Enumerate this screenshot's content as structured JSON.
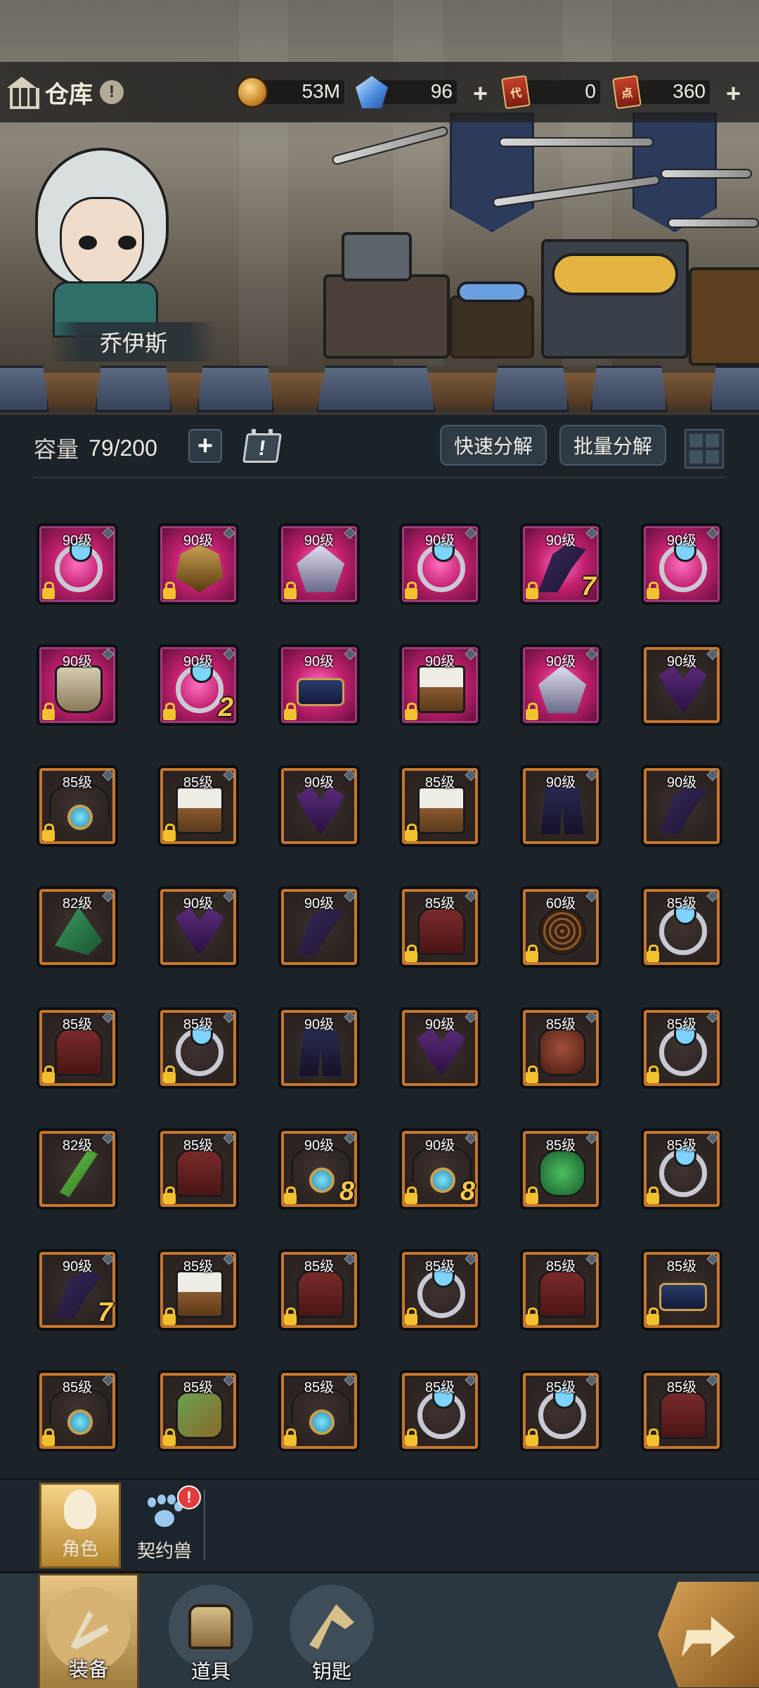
{
  "header": {
    "title": "仓库",
    "info_icon": "!",
    "resources": [
      {
        "icon": "coin-icon",
        "value": "53M",
        "has_plus": false
      },
      {
        "icon": "crystal-icon",
        "value": "96",
        "has_plus": true
      },
      {
        "icon": "ticket-icon",
        "ticket_mark": "代",
        "value": "0",
        "has_plus": false
      },
      {
        "icon": "ticket-icon",
        "ticket_mark": "点",
        "value": "360",
        "has_plus": true
      }
    ],
    "plus_symbol": "+"
  },
  "character": {
    "name": "乔伊斯"
  },
  "capacity": {
    "label": "容量",
    "value": "79/200",
    "plus_symbol": "+"
  },
  "actions": {
    "quick_decompose": "快速分解",
    "batch_decompose": "批量分解"
  },
  "items": [
    [
      {
        "lvl": "90级",
        "q": "purple",
        "art": "ring"
      },
      {
        "lvl": "90级",
        "q": "purple",
        "art": "gold"
      },
      {
        "lvl": "90级",
        "q": "purple",
        "art": "spike"
      },
      {
        "lvl": "90级",
        "q": "purple",
        "art": "ring"
      },
      {
        "lvl": "90级",
        "q": "purple",
        "art": "claw",
        "count": "7"
      },
      {
        "lvl": "90级",
        "q": "purple",
        "art": "ring"
      }
    ],
    [
      {
        "lvl": "90级",
        "q": "purple",
        "art": "armor"
      },
      {
        "lvl": "90级",
        "q": "purple",
        "art": "ring",
        "count": "2"
      },
      {
        "lvl": "90级",
        "q": "purple",
        "art": "belt"
      },
      {
        "lvl": "90级",
        "q": "purple",
        "art": "boots"
      },
      {
        "lvl": "90级",
        "q": "purple",
        "art": "spike"
      },
      {
        "lvl": "90级",
        "q": "orange",
        "art": "mask",
        "lock": false
      }
    ],
    [
      {
        "lvl": "85级",
        "q": "orange",
        "art": "amulet"
      },
      {
        "lvl": "85级",
        "q": "orange",
        "art": "boots"
      },
      {
        "lvl": "90级",
        "q": "orange",
        "art": "mask",
        "lock": false
      },
      {
        "lvl": "85级",
        "q": "orange",
        "art": "boots"
      },
      {
        "lvl": "90级",
        "q": "orange",
        "art": "pants",
        "lock": false
      },
      {
        "lvl": "90级",
        "q": "orange",
        "art": "claw",
        "lock": false
      }
    ],
    [
      {
        "lvl": "82级",
        "q": "orange",
        "art": "hat",
        "lock": false
      },
      {
        "lvl": "90级",
        "q": "orange",
        "art": "mask",
        "lock": false
      },
      {
        "lvl": "90级",
        "q": "orange",
        "art": "claw",
        "lock": false
      },
      {
        "lvl": "85级",
        "q": "orange",
        "art": "fur"
      },
      {
        "lvl": "60级",
        "q": "orange",
        "art": "net"
      },
      {
        "lvl": "85级",
        "q": "orange",
        "art": "ring"
      }
    ],
    [
      {
        "lvl": "85级",
        "q": "orange",
        "art": "fur"
      },
      {
        "lvl": "85级",
        "q": "orange",
        "art": "ring"
      },
      {
        "lvl": "90级",
        "q": "orange",
        "art": "pants",
        "lock": false
      },
      {
        "lvl": "90级",
        "q": "orange",
        "art": "mask",
        "lock": false
      },
      {
        "lvl": "85级",
        "q": "orange",
        "art": "wolf"
      },
      {
        "lvl": "85级",
        "q": "orange",
        "art": "ring"
      }
    ],
    [
      {
        "lvl": "82级",
        "q": "orange",
        "art": "blade",
        "lock": false
      },
      {
        "lvl": "85级",
        "q": "orange",
        "art": "fur"
      },
      {
        "lvl": "90级",
        "q": "orange",
        "art": "amulet",
        "count": "8"
      },
      {
        "lvl": "90级",
        "q": "orange",
        "art": "amulet",
        "count": "8"
      },
      {
        "lvl": "85级",
        "q": "orange",
        "art": "leaf"
      },
      {
        "lvl": "85级",
        "q": "orange",
        "art": "ring"
      }
    ],
    [
      {
        "lvl": "90级",
        "q": "orange",
        "art": "claw",
        "count": "7",
        "lock": false
      },
      {
        "lvl": "85级",
        "q": "orange",
        "art": "boots"
      },
      {
        "lvl": "85级",
        "q": "orange",
        "art": "fur"
      },
      {
        "lvl": "85级",
        "q": "orange",
        "art": "ring"
      },
      {
        "lvl": "85级",
        "q": "orange",
        "art": "fur"
      },
      {
        "lvl": "85级",
        "q": "orange",
        "art": "belt"
      }
    ],
    [
      {
        "lvl": "85级",
        "q": "orange",
        "art": "amulet"
      },
      {
        "lvl": "85级",
        "q": "orange",
        "art": "bracer"
      },
      {
        "lvl": "85级",
        "q": "orange",
        "art": "amulet"
      },
      {
        "lvl": "85级",
        "q": "orange",
        "art": "ring"
      },
      {
        "lvl": "85级",
        "q": "orange",
        "art": "ring"
      },
      {
        "lvl": "85级",
        "q": "orange",
        "art": "fur"
      }
    ]
  ],
  "subtabs": [
    {
      "label": "角色",
      "active": true,
      "icon": "character-icon"
    },
    {
      "label": "契约兽",
      "active": false,
      "icon": "paw-icon",
      "alert": "!"
    }
  ],
  "nav": [
    {
      "label": "装备",
      "active": true,
      "icon": "equipment-icon"
    },
    {
      "label": "道具",
      "active": false,
      "icon": "chest-icon"
    },
    {
      "label": "钥匙",
      "active": false,
      "icon": "key-icon"
    }
  ],
  "colors": {
    "purple_frame": "#c2206f",
    "orange_frame": "#c7762d",
    "lock": "#f2c12e",
    "count": "#f6c64a"
  }
}
